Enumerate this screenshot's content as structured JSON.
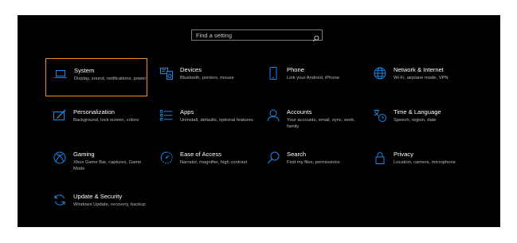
{
  "search": {
    "placeholder": "Find a setting",
    "icon": "search-icon"
  },
  "accent_color": "#1e88e5",
  "selection_color": "#f08a24",
  "tiles": [
    {
      "title": "System",
      "desc": "Display, sound, notifications, power",
      "icon": "laptop-icon",
      "selected": true
    },
    {
      "title": "Devices",
      "desc": "Bluetooth, printers, mouse",
      "icon": "keyboard-speaker-icon"
    },
    {
      "title": "Phone",
      "desc": "Link your Android, iPhone",
      "icon": "phone-icon"
    },
    {
      "title": "Network & Internet",
      "desc": "Wi-Fi, airplane mode, VPN",
      "icon": "globe-icon"
    },
    {
      "title": "Personalization",
      "desc": "Background, lock screen, colors",
      "icon": "paint-icon"
    },
    {
      "title": "Apps",
      "desc": "Uninstall, defaults, optional features",
      "icon": "apps-list-icon"
    },
    {
      "title": "Accounts",
      "desc": "Your accounts, email, sync, work, family",
      "icon": "person-icon"
    },
    {
      "title": "Time & Language",
      "desc": "Speech, region, date",
      "icon": "time-language-icon"
    },
    {
      "title": "Gaming",
      "desc": "Xbox Game Bar, captures, Game Mode",
      "icon": "xbox-icon"
    },
    {
      "title": "Ease of Access",
      "desc": "Narrator, magnifier, high contrast",
      "icon": "ease-of-access-icon"
    },
    {
      "title": "Search",
      "desc": "Find my files, permissions",
      "icon": "search-icon"
    },
    {
      "title": "Privacy",
      "desc": "Location, camera, microphone",
      "icon": "lock-icon"
    },
    {
      "title": "Update & Security",
      "desc": "Windows Update, recovery, backup",
      "icon": "sync-icon"
    }
  ]
}
